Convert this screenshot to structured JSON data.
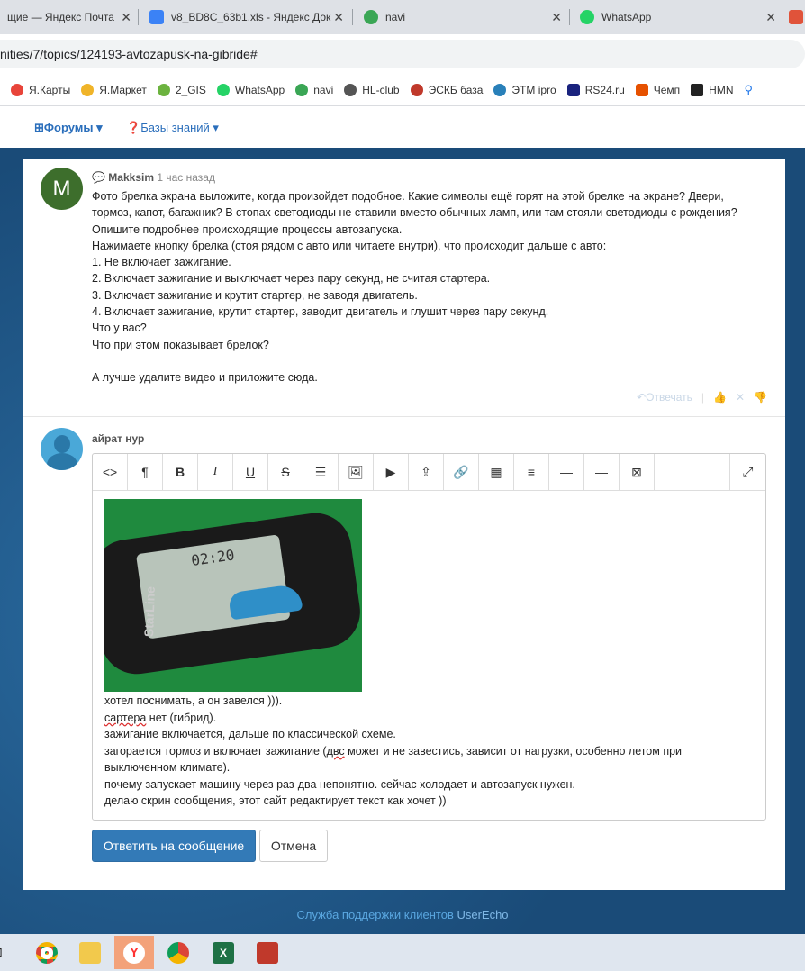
{
  "browser": {
    "tabs": [
      {
        "title": "щие — Яндекс Почта",
        "icon": "mail-icon"
      },
      {
        "title": "v8_BD8C_63b1.xls - Яндекс Док",
        "icon": "doc-icon"
      },
      {
        "title": "navi",
        "icon": "globe-icon"
      },
      {
        "title": "WhatsApp",
        "icon": "whatsapp-icon"
      }
    ],
    "address": "nities/7/topics/124193-avtozapusk-na-gibride#",
    "bookmarks": [
      "Я.Карты",
      "Я.Маркет",
      "2_GIS",
      "WhatsApp",
      "navi",
      "HL-club",
      "ЭСКБ база",
      "ЭТМ ipro",
      "RS24.ru",
      "Чемп",
      "HMN"
    ]
  },
  "nav": {
    "forums": "Форумы",
    "kb": "Базы знаний"
  },
  "post1": {
    "author": "Makksim",
    "time": "1 час назад",
    "avatar_letter": "M",
    "lines": [
      "Фото брелка экрана выложите, когда произойдет подобное. Какие символы ещё горят на этой брелке на экране? Двери,",
      "тормоз, капот, багажник? В стопах светодиоды не ставили вместо обычных ламп, или там стояли светодиоды с рождения?",
      "Опишите подробнее происходящие процессы автозапуска.",
      "Нажимаете кнопку брелка (стоя рядом с авто или читаете внутри), что происходит дальше с авто:",
      "1. Не включает зажигание.",
      "2. Включает зажигание и выключает через пару секунд, не считая стартера.",
      "3. Включает зажигание и крутит стартер, не заводя двигатель.",
      "4. Включает зажигание, крутит стартер, заводит двигатель и глушит через пару секунд.",
      "Что у вас?",
      "Что при этом показывает брелок?",
      "",
      "А лучше удалите видео и приложите сюда."
    ],
    "reply": "Отвечать"
  },
  "post2": {
    "author": "айрат нур",
    "photo_time": "02:20",
    "photo_brand": "StarLine",
    "lines_a": [
      "хотел поснимать, а он завелся ))).",
      "сартера",
      " нет (гибрид).",
      "зажигание включается, дальше по классической схеме.",
      "загорается тормоз и включает зажигание (",
      "двс",
      " может и не завестись, зависит от нагрузки, особенно летом при",
      "выключенном климате).",
      "почему запускает машину через раз-два непонятно. сейчас холодает и автозапуск нужен.",
      "делаю скрин сообщения, этот сайт редактирует текст как хочет ))"
    ],
    "submit": "Ответить на сообщение",
    "cancel": "Отмена"
  },
  "footer": {
    "text": "Служба поддержки клиентов",
    "brand": "UserEcho"
  },
  "colors": {
    "link": "#2a6ebb",
    "primary": "#337ab7",
    "avatar_m": "#3d6e2c",
    "avatar_u": "#4aa8d8"
  }
}
